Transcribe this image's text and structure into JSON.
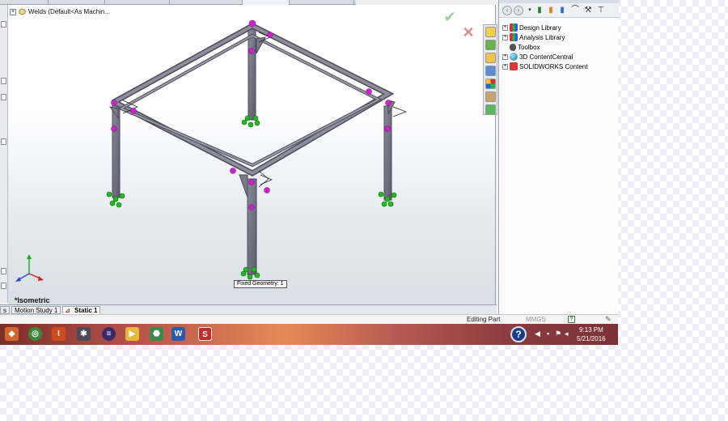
{
  "window": {
    "part_tree_item": "Welds  (Default<As Machin...",
    "view_orientation": "*Isometric",
    "callout_text": "Fixed Geometry: 1"
  },
  "study_tabs": [
    {
      "label": "s"
    },
    {
      "label": "Motion Study 1"
    },
    {
      "label": "Static 1",
      "active": true
    }
  ],
  "design_library": {
    "title": "Design Library",
    "items": [
      {
        "label": "Design Library",
        "icon": "design-library-icon",
        "expandable": true
      },
      {
        "label": "Analysis Library",
        "icon": "analysis-library-icon",
        "expandable": true
      },
      {
        "label": "Toolbox",
        "icon": "toolbox-icon",
        "expandable": false
      },
      {
        "label": "3D ContentCentral",
        "icon": "globe-icon",
        "expandable": true
      },
      {
        "label": "SOLIDWORKS Content",
        "icon": "solidworks-content-icon",
        "expandable": true
      }
    ]
  },
  "status_bar": {
    "mode": "Editing Part",
    "units": "MMGS",
    "help": "?"
  },
  "taskbar": {
    "time": "9:13 PM",
    "date": "5/21/2016"
  },
  "colors": {
    "beam": "#6f6f80",
    "joint": "#cc22cc",
    "fixture": "#22bb22",
    "taskbar_accent": "#e48b55"
  }
}
